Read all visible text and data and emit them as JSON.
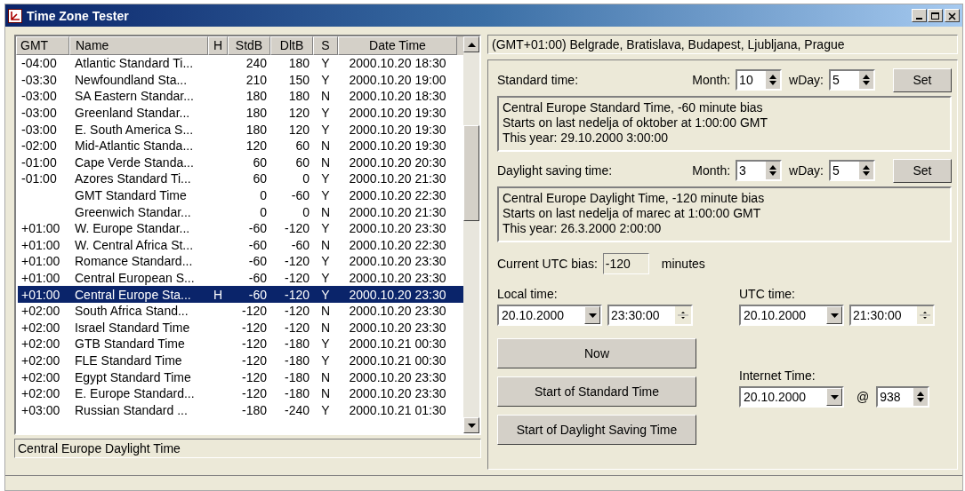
{
  "window": {
    "title": "Time Zone Tester"
  },
  "table": {
    "columns": [
      "GMT",
      "Name",
      "H",
      "StdB",
      "DltB",
      "S",
      "Date Time"
    ],
    "rows": [
      {
        "gmt": "-04:00",
        "name": "Atlantic Standard Ti...",
        "stdb": "240",
        "dltb": "180",
        "s": "Y",
        "datetime": "2000.10.20 18:30",
        "selected": false
      },
      {
        "gmt": "-03:30",
        "name": "Newfoundland Sta...",
        "stdb": "210",
        "dltb": "150",
        "s": "Y",
        "datetime": "2000.10.20 19:00",
        "selected": false
      },
      {
        "gmt": "-03:00",
        "name": "SA Eastern Standar...",
        "stdb": "180",
        "dltb": "180",
        "s": "N",
        "datetime": "2000.10.20 18:30",
        "selected": false
      },
      {
        "gmt": "-03:00",
        "name": "Greenland Standar...",
        "stdb": "180",
        "dltb": "120",
        "s": "Y",
        "datetime": "2000.10.20 19:30",
        "selected": false
      },
      {
        "gmt": "-03:00",
        "name": "E. South America S...",
        "stdb": "180",
        "dltb": "120",
        "s": "Y",
        "datetime": "2000.10.20 19:30",
        "selected": false
      },
      {
        "gmt": "-02:00",
        "name": "Mid-Atlantic Standa...",
        "stdb": "120",
        "dltb": "60",
        "s": "N",
        "datetime": "2000.10.20 19:30",
        "selected": false
      },
      {
        "gmt": "-01:00",
        "name": "Cape Verde Standa...",
        "stdb": "60",
        "dltb": "60",
        "s": "N",
        "datetime": "2000.10.20 20:30",
        "selected": false
      },
      {
        "gmt": "-01:00",
        "name": "Azores Standard Ti...",
        "stdb": "60",
        "dltb": "0",
        "s": "Y",
        "datetime": "2000.10.20 21:30",
        "selected": false
      },
      {
        "name": "GMT Standard Time",
        "stdb": "0",
        "dltb": "-60",
        "s": "Y",
        "datetime": "2000.10.20 22:30",
        "selected": false
      },
      {
        "name": "Greenwich Standar...",
        "stdb": "0",
        "dltb": "0",
        "s": "N",
        "datetime": "2000.10.20 21:30",
        "selected": false
      },
      {
        "gmt": "+01:00",
        "name": "W. Europe Standar...",
        "stdb": "-60",
        "dltb": "-120",
        "s": "Y",
        "datetime": "2000.10.20 23:30",
        "selected": false
      },
      {
        "gmt": "+01:00",
        "name": "W. Central Africa St...",
        "stdb": "-60",
        "dltb": "-60",
        "s": "N",
        "datetime": "2000.10.20 22:30",
        "selected": false
      },
      {
        "gmt": "+01:00",
        "name": "Romance Standard...",
        "stdb": "-60",
        "dltb": "-120",
        "s": "Y",
        "datetime": "2000.10.20 23:30",
        "selected": false
      },
      {
        "gmt": "+01:00",
        "name": "Central European S...",
        "stdb": "-60",
        "dltb": "-120",
        "s": "Y",
        "datetime": "2000.10.20 23:30",
        "selected": false
      },
      {
        "gmt": "+01:00",
        "name": "Central Europe Sta...",
        "h": "H",
        "stdb": "-60",
        "dltb": "-120",
        "s": "Y",
        "datetime": "2000.10.20 23:30",
        "selected": true
      },
      {
        "gmt": "+02:00",
        "name": "South Africa Stand...",
        "stdb": "-120",
        "dltb": "-120",
        "s": "N",
        "datetime": "2000.10.20 23:30",
        "selected": false
      },
      {
        "gmt": "+02:00",
        "name": "Israel Standard Time",
        "stdb": "-120",
        "dltb": "-120",
        "s": "N",
        "datetime": "2000.10.20 23:30",
        "selected": false
      },
      {
        "gmt": "+02:00",
        "name": "GTB Standard Time",
        "stdb": "-120",
        "dltb": "-180",
        "s": "Y",
        "datetime": "2000.10.21 00:30",
        "selected": false
      },
      {
        "gmt": "+02:00",
        "name": "FLE Standard Time",
        "stdb": "-120",
        "dltb": "-180",
        "s": "Y",
        "datetime": "2000.10.21 00:30",
        "selected": false
      },
      {
        "gmt": "+02:00",
        "name": "Egypt Standard Time",
        "stdb": "-120",
        "dltb": "-180",
        "s": "N",
        "datetime": "2000.10.20 23:30",
        "selected": false
      },
      {
        "gmt": "+02:00",
        "name": "E. Europe Standard...",
        "stdb": "-120",
        "dltb": "-180",
        "s": "N",
        "datetime": "2000.10.20 23:30",
        "selected": false
      },
      {
        "gmt": "+03:00",
        "name": "Russian Standard ...",
        "stdb": "-180",
        "dltb": "-240",
        "s": "Y",
        "datetime": "2000.10.21 01:30",
        "selected": false
      }
    ]
  },
  "selected_zone_name": "Central Europe Daylight Time",
  "zone_display": "(GMT+01:00) Belgrade, Bratislava, Budapest, Ljubljana, Prague",
  "rules": [
    {
      "label": "Standard time:",
      "month_label": "Month:",
      "month": "10",
      "wday_label": "wDay:",
      "wday": "5",
      "button": "Set",
      "info": [
        "Central Europe Standard Time, -60 minute bias",
        "Starts on last nedelja of oktober at 1:00:00 GMT",
        "This year: 29.10.2000 3:00:00"
      ]
    },
    {
      "label": "Daylight saving time:",
      "month_label": "Month:",
      "month": "3",
      "wday_label": "wDay:",
      "wday": "5",
      "button": "Set",
      "info": [
        "Central Europe Daylight Time, -120 minute bias",
        "Starts on last nedelja of marec at 1:00:00 GMT",
        "This year: 26.3.2000 2:00:00"
      ]
    }
  ],
  "bias": {
    "label": "Current UTC bias:",
    "value": "-120",
    "unit": "minutes"
  },
  "local_time": {
    "label": "Local time:",
    "date": "20.10.2000",
    "time": "23:30:00"
  },
  "utc_time": {
    "label": "UTC time:",
    "date": "20.10.2000",
    "time": "21:30:00"
  },
  "buttons": [
    "Now",
    "Start of Standard Time",
    "Start of Daylight Saving Time"
  ],
  "internet_time": {
    "label": "Internet Time:",
    "date": "20.10.2000",
    "at": "@",
    "beats": "938"
  }
}
